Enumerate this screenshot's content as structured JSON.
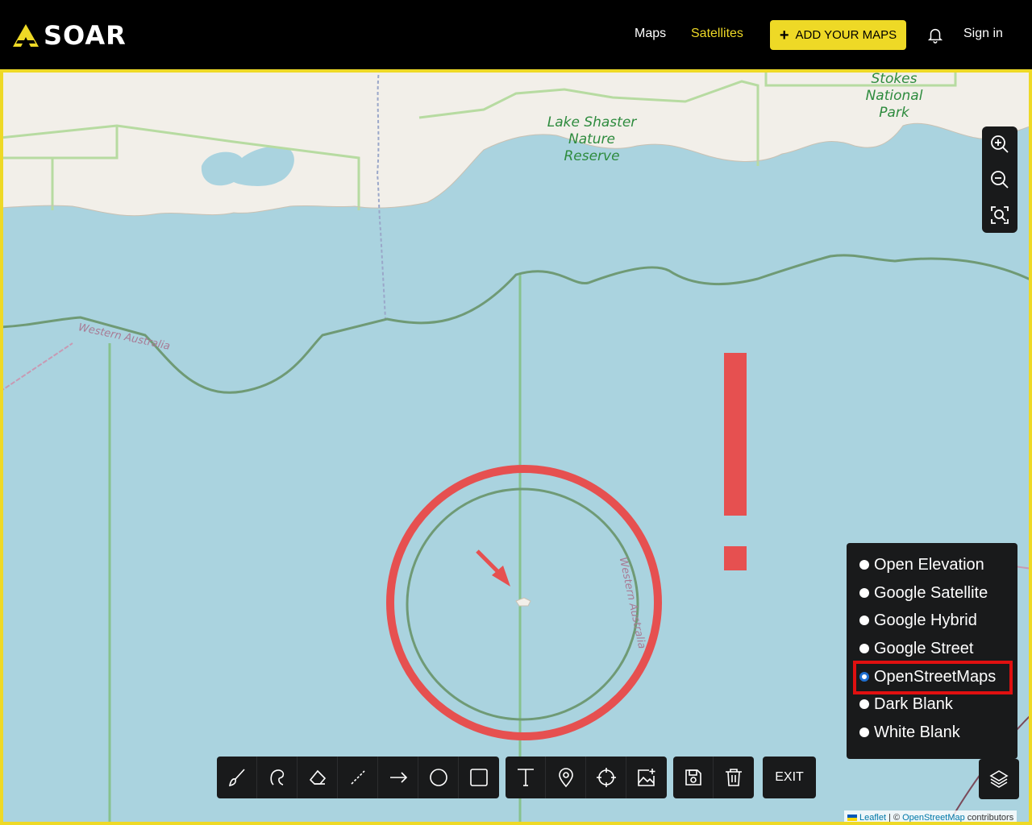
{
  "header": {
    "logo_text": "SOAR",
    "nav": {
      "maps": "Maps",
      "satellites": "Satellites"
    },
    "add_button": "ADD YOUR MAPS",
    "signin": "Sign in"
  },
  "map": {
    "labels": {
      "stokes": "Stokes\nNational\nPark",
      "shaster": "Lake Shaster\nNature\nReserve",
      "wa_left": "Western Australia",
      "wa_circle": "Western Australia"
    }
  },
  "layers": {
    "items": [
      {
        "label": "Open Elevation",
        "selected": false
      },
      {
        "label": "Google Satellite",
        "selected": false
      },
      {
        "label": "Google Hybrid",
        "selected": false
      },
      {
        "label": "Google Street",
        "selected": false
      },
      {
        "label": "OpenStreetMaps",
        "selected": true
      },
      {
        "label": "Dark Blank",
        "selected": false
      },
      {
        "label": "White Blank",
        "selected": false
      }
    ]
  },
  "toolbar": {
    "draw_tools": [
      "brush-icon",
      "lasso-icon",
      "eraser-icon",
      "line-icon",
      "arrow-icon",
      "circle-icon",
      "rectangle-icon"
    ],
    "annotate_tools": [
      "text-icon",
      "marker-icon",
      "crosshair-icon",
      "image-add-icon"
    ],
    "file_tools": [
      "save-icon",
      "trash-icon"
    ],
    "exit_label": "EXIT"
  },
  "attribution": {
    "leaflet": "Leaflet",
    "separator": " | © ",
    "osm": "OpenStreetMap",
    "suffix": " contributors"
  },
  "colors": {
    "accent": "#eed926",
    "water": "#aad3df",
    "land": "#f2efe9",
    "annotation_red": "#e65050",
    "highlight_red": "#e01010"
  }
}
